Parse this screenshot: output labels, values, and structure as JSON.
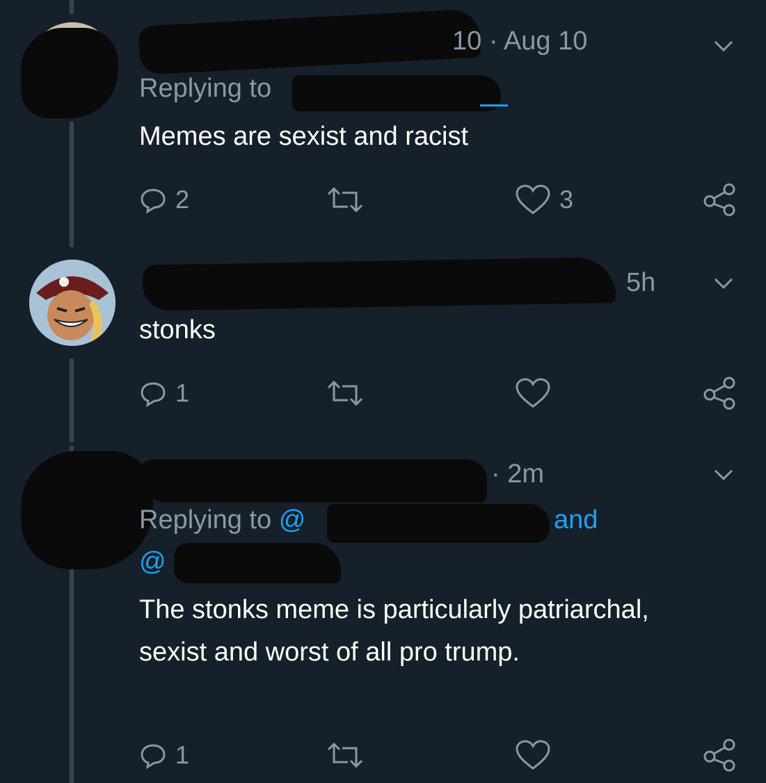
{
  "tweets": [
    {
      "time": "10 · Aug 10",
      "replying_label": "Replying to",
      "text": "Memes are sexist and racist",
      "reply_count": "2",
      "like_count": "3"
    },
    {
      "time": "5h",
      "text": "stonks",
      "reply_count": "1",
      "like_count": ""
    },
    {
      "time": "· 2m",
      "replying_label": "Replying to",
      "mention_1": "@",
      "mention_and": "and",
      "mention_2": "@",
      "text": "The stonks meme is particularly patriarchal, sexist and worst of all pro trump.",
      "reply_count": "1",
      "like_count": ""
    }
  ],
  "colors": {
    "background": "#15202b",
    "secondary_text": "#8899a6",
    "link": "#1da1f2",
    "thread_line": "#38444d"
  }
}
